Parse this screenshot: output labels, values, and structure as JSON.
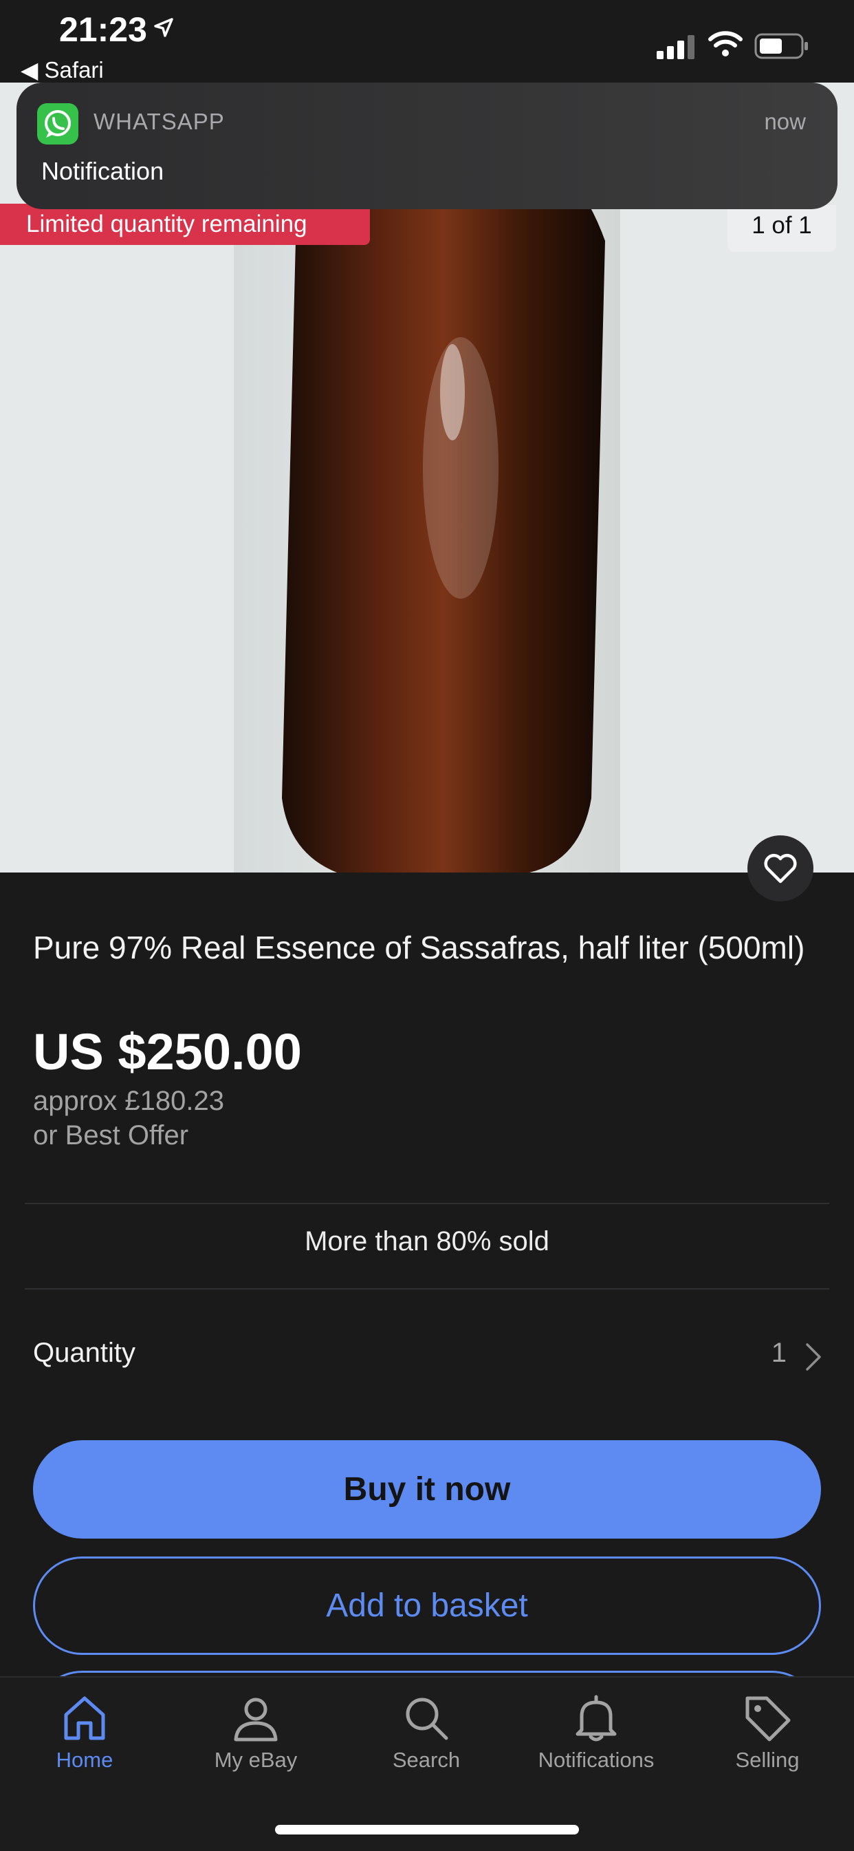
{
  "status_bar": {
    "time": "21:23",
    "back_app": "◀ Safari"
  },
  "notification": {
    "app": "WHATSAPP",
    "time": "now",
    "body": "Notification"
  },
  "image": {
    "badge": "Limited quantity remaining",
    "counter": "1 of 1"
  },
  "listing": {
    "title": "Pure 97% Real Essence of Sassafras, half liter (500ml)",
    "price": "US $250.00",
    "approx": "approx £180.23",
    "best_offer": "or Best Offer",
    "sold": "More than 80% sold",
    "quantity_label": "Quantity",
    "quantity_value": "1"
  },
  "actions": {
    "buy_now": "Buy it now",
    "add_to_basket": "Add to basket"
  },
  "tab_bar": [
    {
      "label": "Home",
      "icon": "home-icon",
      "active": true
    },
    {
      "label": "My eBay",
      "icon": "person-icon",
      "active": false
    },
    {
      "label": "Search",
      "icon": "search-icon",
      "active": false
    },
    {
      "label": "Notifications",
      "icon": "bell-icon",
      "active": false
    },
    {
      "label": "Selling",
      "icon": "tag-icon",
      "active": false
    }
  ],
  "colors": {
    "accent": "#5e8bf2",
    "badge": "#d9334b",
    "background": "#1a1a1b",
    "whatsapp": "#36c14b"
  }
}
